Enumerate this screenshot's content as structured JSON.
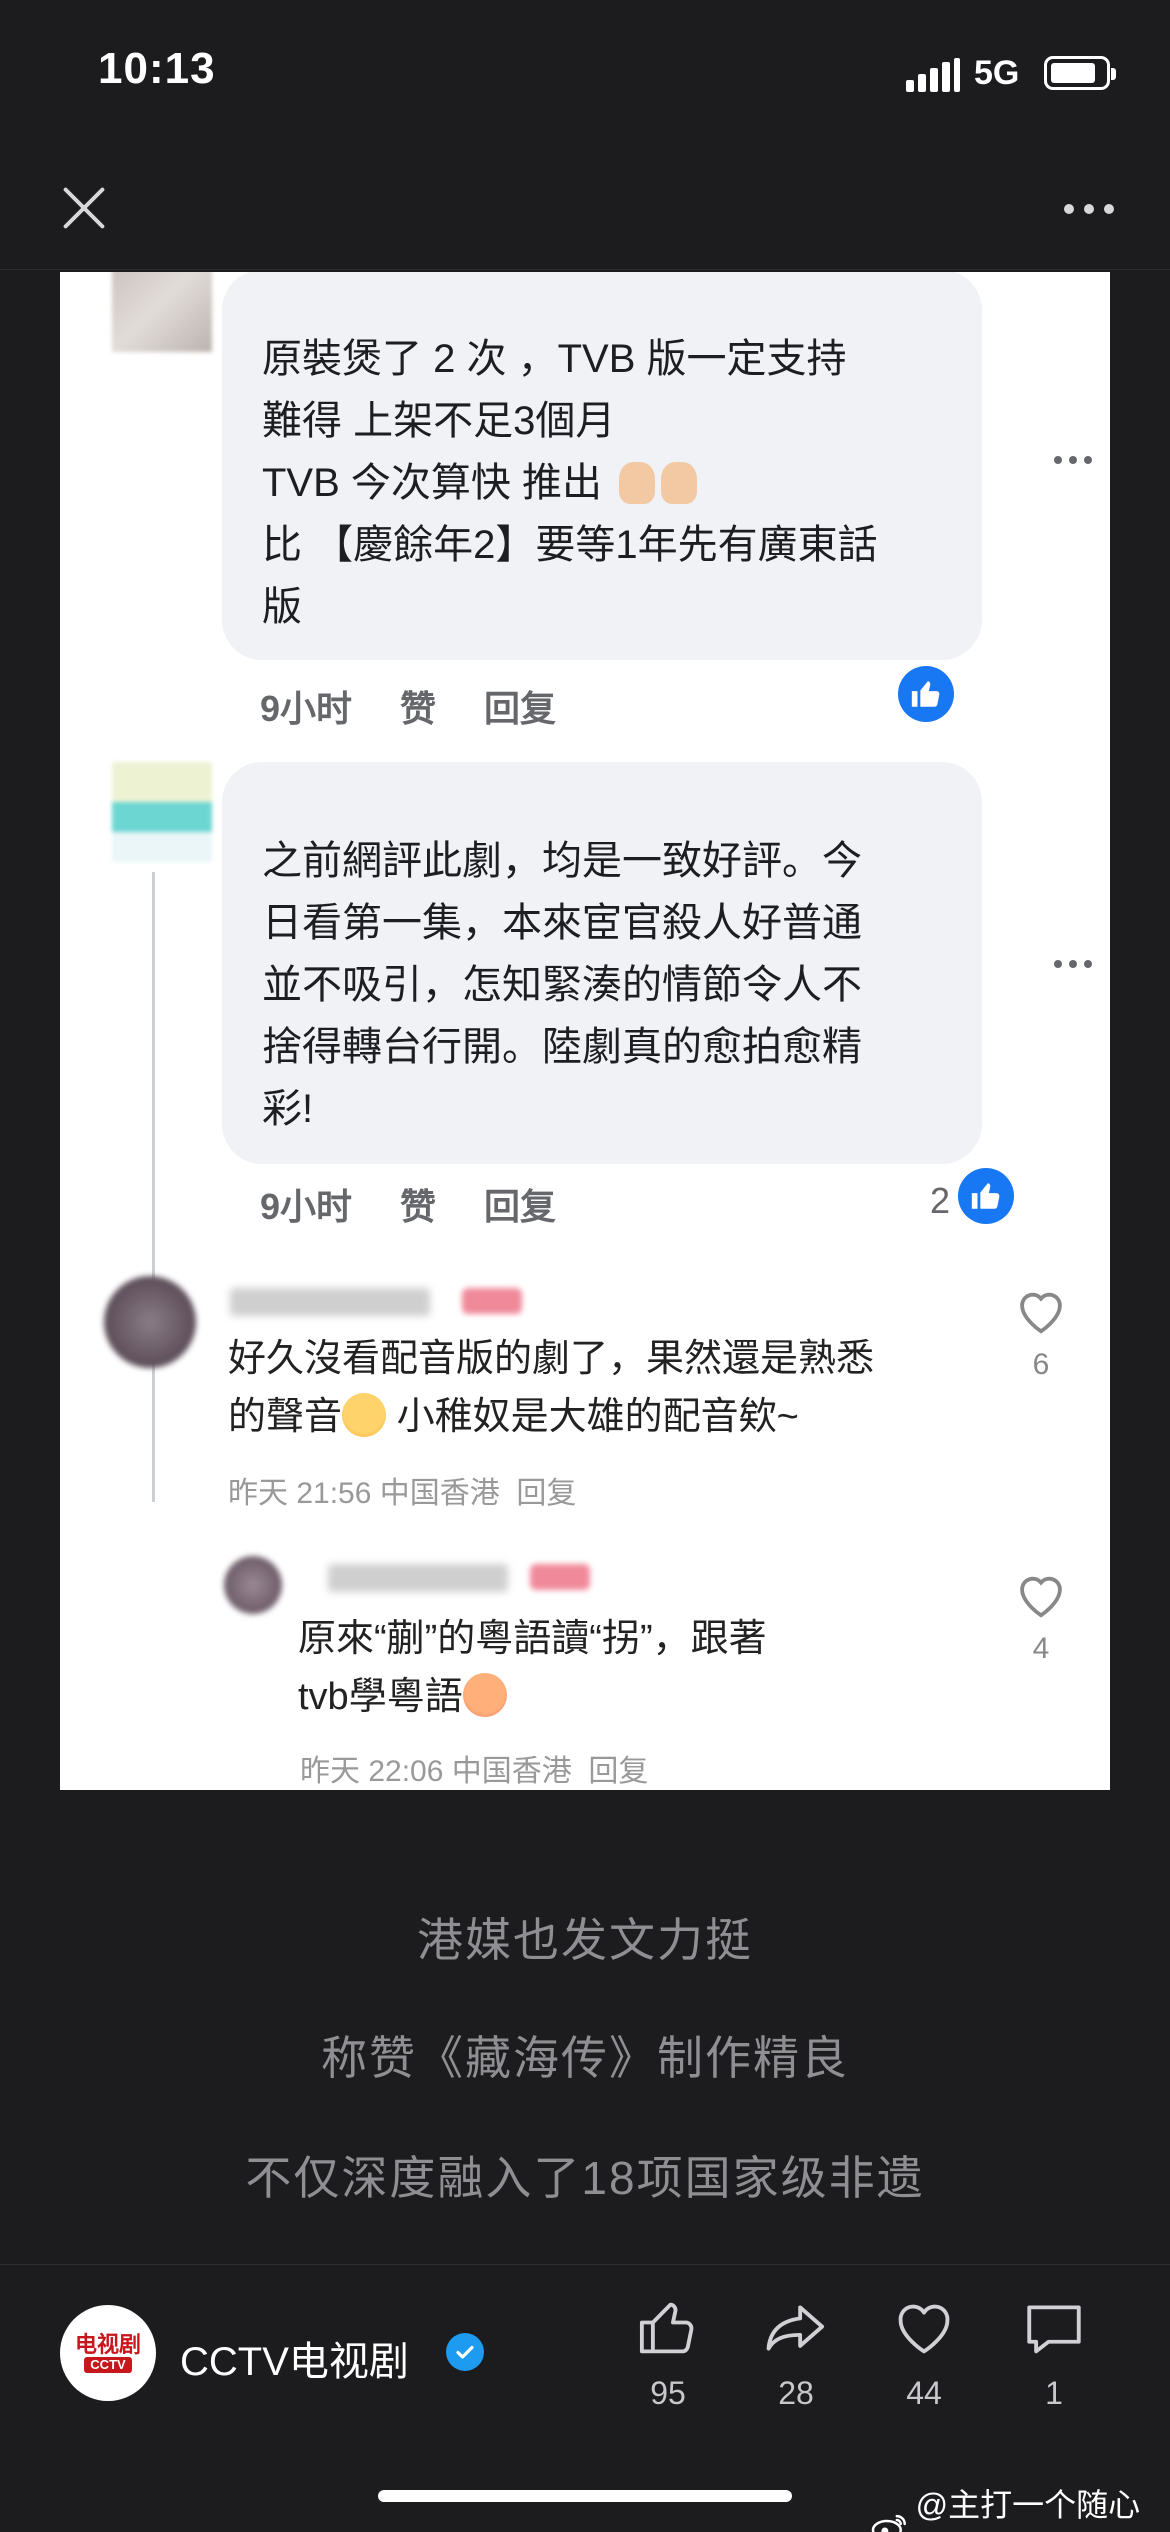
{
  "status_bar": {
    "time": "10:13",
    "network": "5G"
  },
  "nav": {
    "close_icon": "close-icon",
    "more_icon": "more-icon"
  },
  "fb_comments": [
    {
      "lines": [
        "原裝煲了 2 次 ，TVB 版一定支持",
        "難得 上架不足3個月",
        "TVB 今次算快 推出",
        "比 【慶餘年2】要等1年先有廣東話",
        "版"
      ],
      "time": "9小时",
      "like_label": "赞",
      "reply_label": "回复"
    },
    {
      "lines": [
        "之前網評此劇，均是一致好評。今",
        "日看第一集，本來宦官殺人好普通",
        "並不吸引，怎知緊湊的情節令人不",
        "捨得轉台行開。陸劇真的愈拍愈精",
        "彩!"
      ],
      "time": "9小时",
      "like_label": "赞",
      "reply_label": "回复",
      "reaction_count": "2"
    }
  ],
  "wb_comments": [
    {
      "line1": "好久沒看配音版的劇了，果然還是熟悉",
      "line2a": "的聲音",
      "line2b": " 小稚奴是大雄的配音欸~",
      "meta": "昨天 21:56 中国香港",
      "reply": "回复",
      "likes": "6"
    },
    {
      "line1": "原來“蒯”的粵語讀“拐”，跟著",
      "line2": "tvb學粵語",
      "meta": "昨天 22:06 中国香港",
      "reply": "回复",
      "likes": "4"
    }
  ],
  "captions": [
    "港媒也发文力挺",
    "称赞《藏海传》制作精良",
    "不仅深度融入了18项国家级非遗"
  ],
  "account": {
    "name": "CCTV电视剧",
    "avatar_line1": "电视剧",
    "avatar_line2": "CCTV"
  },
  "actions": [
    {
      "icon": "thumbs-up-icon",
      "count": "95"
    },
    {
      "icon": "share-icon",
      "count": "28"
    },
    {
      "icon": "heart-icon",
      "count": "44"
    },
    {
      "icon": "comment-icon",
      "count": "1"
    }
  ],
  "watermark": "@主打一个随心瓜",
  "colors": {
    "background": "#1c1c1e",
    "fb_blue": "#1877f2",
    "verified_blue": "#1d9bf0",
    "cctv_red": "#c8161d"
  }
}
